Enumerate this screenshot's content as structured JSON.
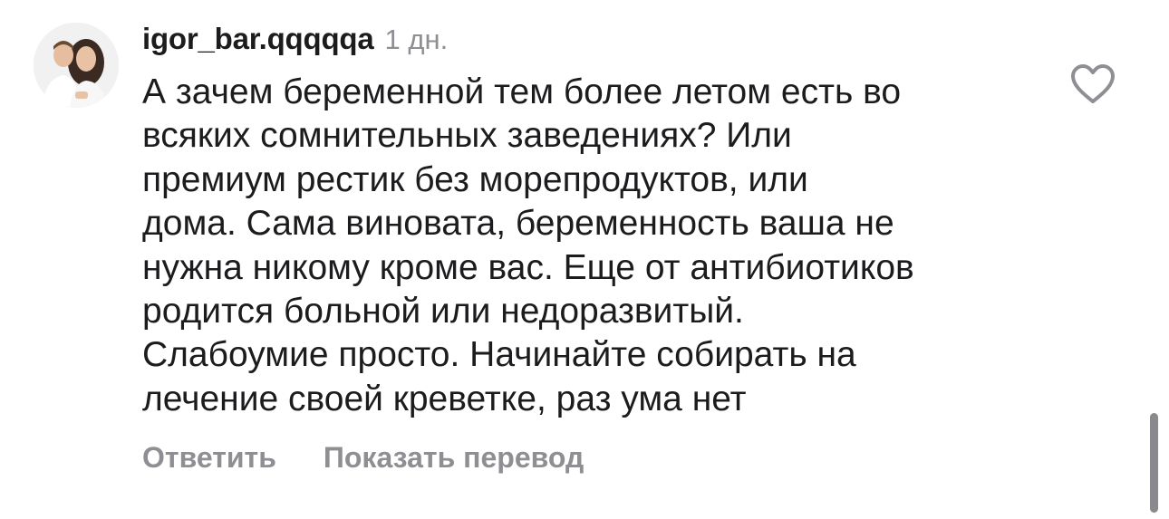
{
  "comment": {
    "avatar_alt": "profile photo",
    "username": "igor_bar.qqqqqa",
    "time": "1 дн.",
    "text": "А зачем беременной тем более летом есть во\nвсяких сомнительных заведениях? Или\nпремиум рестик без морепродуктов, или\nдома. Сама виновата, беременность ваша не\nнужна никому кроме вас. Еще от антибиотиков\nродится больной или недоразвитый.\nСлабоумие просто. Начинайте собирать на\nлечение своей креветке, раз ума нет",
    "like_icon": "heart-outline-icon",
    "actions": {
      "reply": "Ответить",
      "translate": "Показать перевод"
    }
  },
  "colors": {
    "text": "#1c1c1e",
    "secondary": "#8e8e93",
    "background": "#ffffff",
    "scrollbar": "#8a8a8e"
  }
}
